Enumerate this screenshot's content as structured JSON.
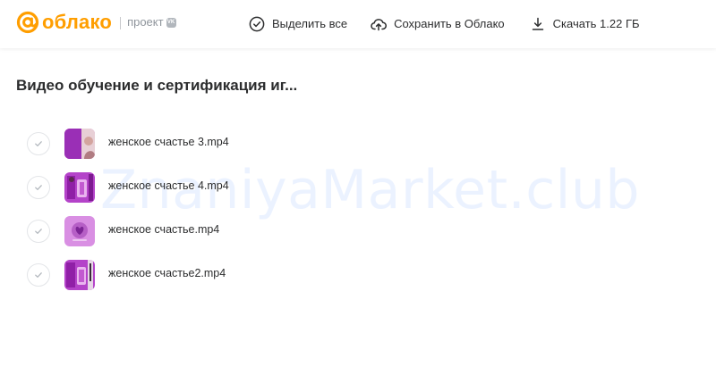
{
  "header": {
    "logo_text": "облако",
    "project_label": "проект",
    "vk_badge": "VK",
    "actions": {
      "select_all": "Выделить все",
      "save_to_cloud": "Сохранить в Облако",
      "download": "Скачать 1.22 ГБ"
    }
  },
  "folder": {
    "title": "Видео обучение и сертификация иг..."
  },
  "files": [
    {
      "name": "женское счастье 3.mp4"
    },
    {
      "name": "женское счастье 4.mp4"
    },
    {
      "name": "женское счастье.mp4"
    },
    {
      "name": "женское счастье2.mp4"
    }
  ],
  "watermark": "ZnaniyaMarket.club",
  "colors": {
    "brand": "#ff9e00",
    "text": "#2c2d2e",
    "muted": "#8f959c",
    "thumb_purple": "#b443c9"
  }
}
